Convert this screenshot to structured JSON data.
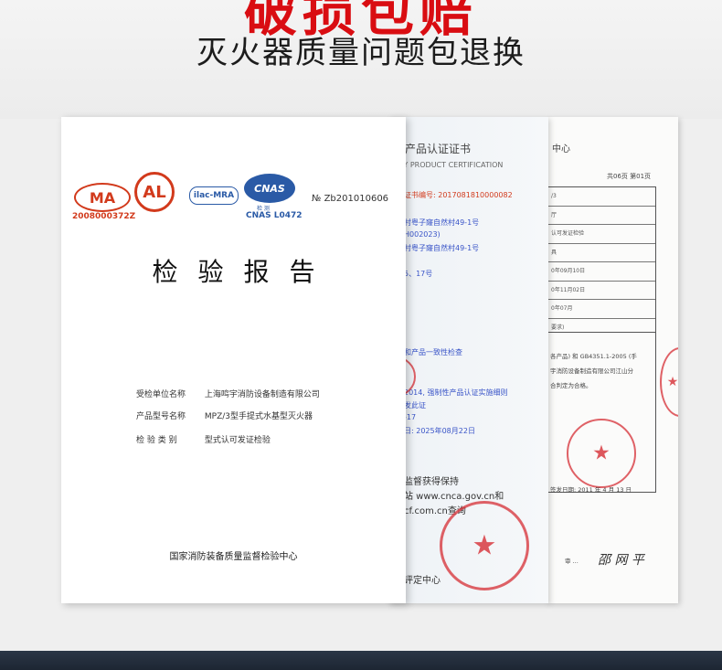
{
  "header": {
    "headline_partial": "破损包赔",
    "subheadline": "灭火器质量问题包退换"
  },
  "report": {
    "logos": {
      "cma": "MA",
      "cma_code": "2008000372Z",
      "cal": "AL",
      "ilac": "ilac-MRA",
      "cnas": "CNAS",
      "cnas_sub": "检 测",
      "cnas_code": "CNAS L0472"
    },
    "report_no": "№ Zb201010606",
    "title": "检验报告",
    "fields": [
      {
        "label": "受检单位名称",
        "value": "上海鸣宇消防设备制造有限公司"
      },
      {
        "label": "产品型号名称",
        "value": "MPZ/3型手提式水基型灭火器"
      },
      {
        "label": "检 验 类 别",
        "value": "型式认可发证检验"
      }
    ],
    "issuer": "国家消防装备质量监督检验中心"
  },
  "certificate": {
    "title": "产品认证证书",
    "subtitle": "SORY PRODUCT CERTIFICATION",
    "lines": [
      {
        "text": "证书编号: 2017081810000082",
        "style": "red"
      },
      {
        "text": "村粤子窿自然村49-1号",
        "style": "blue"
      },
      {
        "text": "H002023)",
        "style": "blue"
      },
      {
        "text": "村粤子窿自然村49-1号",
        "style": "blue"
      },
      {
        "text": "5、17号",
        "style": "blue"
      },
      {
        "text": "和产品一致性检查",
        "style": "blue"
      },
      {
        "text": "2014, 强制性产品认证实施细则",
        "style": "blue"
      },
      {
        "text": "发此证",
        "style": "blue"
      },
      {
        "text": "-17",
        "style": "blue"
      },
      {
        "text": "日: 2025年08月22日",
        "style": "blue"
      },
      {
        "text": "监督获得保持",
        "style": "big"
      },
      {
        "text": "站 www.cnca.gov.cn和",
        "style": "big"
      },
      {
        "text": "cf.com.cn查询",
        "style": "big"
      },
      {
        "text": "评定中心",
        "style": "big"
      }
    ]
  },
  "back_document": {
    "title": "中心",
    "pages": "共06页 第01页",
    "table_rows": [
      "/3",
      "厅",
      "认可发证检验",
      "具",
      "0年09月10日",
      "0年11月02日",
      "0年07月",
      "要求)"
    ],
    "body_lines": [
      "各产品) 和 GB4351.1-2005 (手",
      "宇消防设备制造有限公司江山分",
      "合判定为合格。"
    ],
    "sign_date": "签发日期: 2011 年 4 月 13 日",
    "approver_label": "审 ...",
    "approver_sign": "邵 网 平"
  },
  "colors": {
    "headline_red": "#d90d12",
    "stamp_red": "#d62e34",
    "logo_blue": "#2a5aa6"
  }
}
